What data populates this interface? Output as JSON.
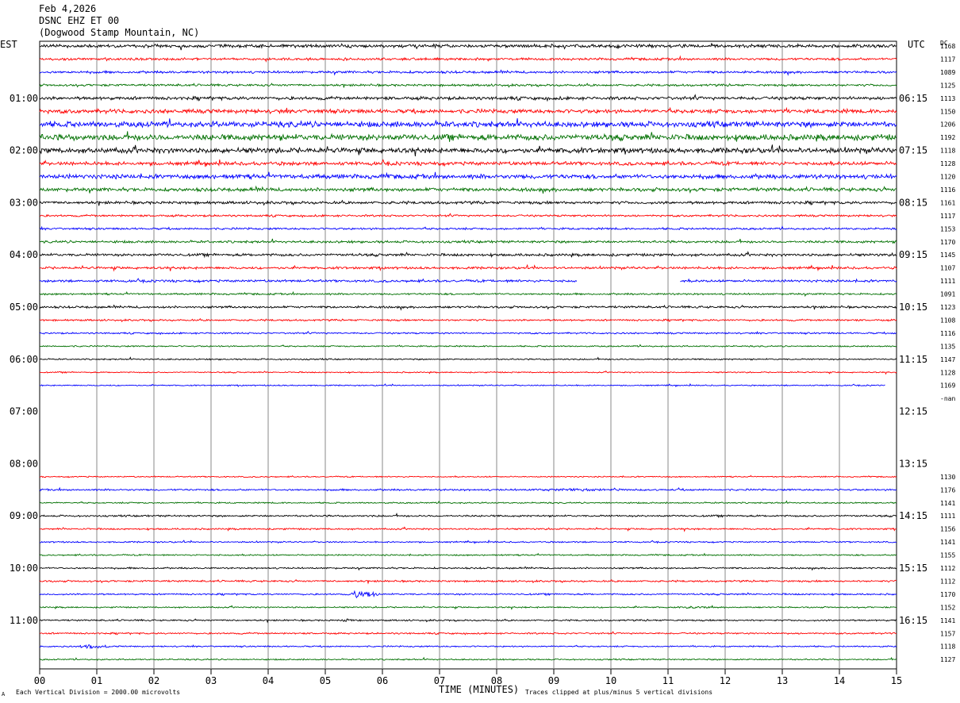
{
  "header": {
    "date": "Feb 4,2026",
    "station": "DSNC EHZ ET 00",
    "location": "(Dogwood Stamp Mountain, NC)"
  },
  "left_timezone": "EST",
  "right_timezone": "UTC",
  "dc_label": "DC",
  "footer": {
    "scale_note": "Each Vertical Division = 2000.00 microvolts",
    "clip_note": "Traces clipped at plus/minus 5 vertical divisions",
    "corner_mark": "A"
  },
  "chart_data": {
    "type": "line",
    "title": "",
    "xlabel": "TIME (MINUTES)",
    "ylabel": "",
    "xlim": [
      0,
      15
    ],
    "x_ticks": [
      "00",
      "01",
      "02",
      "03",
      "04",
      "05",
      "06",
      "07",
      "08",
      "09",
      "10",
      "11",
      "12",
      "13",
      "14",
      "15"
    ],
    "trace_colors": [
      "#000000",
      "#ff0000",
      "#0000ff",
      "#007000"
    ],
    "left_hour_labels": [
      "01:00",
      "02:00",
      "03:00",
      "04:00",
      "05:00",
      "06:00",
      "07:00",
      "08:00",
      "09:00",
      "10:00",
      "11:00"
    ],
    "right_hour_labels": [
      "06:15",
      "07:15",
      "08:15",
      "09:15",
      "10:15",
      "11:15",
      "12:15",
      "13:15",
      "14:15",
      "15:15",
      "16:15"
    ],
    "rows": [
      {
        "row": 0,
        "dc": "1168",
        "level": 1.6
      },
      {
        "row": 1,
        "dc": "1117",
        "level": 1.2
      },
      {
        "row": 2,
        "dc": "1089",
        "level": 1.2
      },
      {
        "row": 3,
        "dc": "1125",
        "level": 1.1
      },
      {
        "row": 4,
        "dc": "1113",
        "level": 1.6
      },
      {
        "row": 5,
        "dc": "1150",
        "level": 2.0
      },
      {
        "row": 6,
        "dc": "1206",
        "level": 2.8
      },
      {
        "row": 7,
        "dc": "1192",
        "level": 3.0
      },
      {
        "row": 8,
        "dc": "1118",
        "level": 2.6
      },
      {
        "row": 9,
        "dc": "1128",
        "level": 1.8
      },
      {
        "row": 10,
        "dc": "1120",
        "level": 2.2
      },
      {
        "row": 11,
        "dc": "1116",
        "level": 1.8
      },
      {
        "row": 12,
        "dc": "1161",
        "level": 1.4
      },
      {
        "row": 13,
        "dc": "1117",
        "level": 1.0
      },
      {
        "row": 14,
        "dc": "1153",
        "level": 1.0
      },
      {
        "row": 15,
        "dc": "1170",
        "level": 1.2
      },
      {
        "row": 16,
        "dc": "1145",
        "level": 1.3
      },
      {
        "row": 17,
        "dc": "1107",
        "level": 1.2
      },
      {
        "row": 18,
        "dc": "1111",
        "level": 1.2,
        "gaps": [
          [
            9.4,
            11.2
          ]
        ]
      },
      {
        "row": 19,
        "dc": "1091",
        "level": 0.9
      },
      {
        "row": 20,
        "dc": "1123",
        "level": 1.1
      },
      {
        "row": 21,
        "dc": "1108",
        "level": 0.9
      },
      {
        "row": 22,
        "dc": "1116",
        "level": 0.8
      },
      {
        "row": 23,
        "dc": "1135",
        "level": 0.7
      },
      {
        "row": 24,
        "dc": "1147",
        "level": 0.7
      },
      {
        "row": 25,
        "dc": "1128",
        "level": 0.6
      },
      {
        "row": 26,
        "dc": "1169",
        "level": 0.6,
        "end": 14.8
      },
      {
        "row": 27,
        "dc": "-nan",
        "level": 0,
        "empty": true
      },
      {
        "row": 28,
        "dc": "",
        "level": 0,
        "empty": true
      },
      {
        "row": 29,
        "dc": "",
        "level": 0,
        "empty": true
      },
      {
        "row": 30,
        "dc": "",
        "level": 0,
        "empty": true
      },
      {
        "row": 31,
        "dc": "",
        "level": 0,
        "empty": true
      },
      {
        "row": 32,
        "dc": "",
        "level": 0,
        "empty": true
      },
      {
        "row": 33,
        "dc": "1130",
        "level": 0.6
      },
      {
        "row": 34,
        "dc": "1176",
        "level": 0.9
      },
      {
        "row": 35,
        "dc": "1141",
        "level": 0.7
      },
      {
        "row": 36,
        "dc": "1111",
        "level": 0.9
      },
      {
        "row": 37,
        "dc": "1156",
        "level": 0.8
      },
      {
        "row": 38,
        "dc": "1141",
        "level": 0.7
      },
      {
        "row": 39,
        "dc": "1155",
        "level": 0.7
      },
      {
        "row": 40,
        "dc": "1112",
        "level": 0.8
      },
      {
        "row": 41,
        "dc": "1112",
        "level": 0.9
      },
      {
        "row": 42,
        "dc": "1170",
        "level": 0.8
      },
      {
        "row": 43,
        "dc": "1152",
        "level": 0.7
      },
      {
        "row": 44,
        "dc": "1141",
        "level": 0.8
      },
      {
        "row": 45,
        "dc": "1157",
        "level": 0.8
      },
      {
        "row": 46,
        "dc": "1118",
        "level": 0.7
      },
      {
        "row": 47,
        "dc": "1127",
        "level": 0.7
      }
    ],
    "events": [
      {
        "row": 42,
        "start": 5.45,
        "end": 5.95,
        "amplitude": 5
      },
      {
        "row": 46,
        "start": 0.7,
        "end": 1.3,
        "amplitude": 2.5
      },
      {
        "row": 34,
        "start": 8.6,
        "end": 11.2,
        "amplitude": 1.6
      },
      {
        "row": 44,
        "start": 5.3,
        "end": 5.6,
        "amplitude": 2.5
      },
      {
        "row": 43,
        "start": 11.3,
        "end": 11.8,
        "amplitude": 2.0
      }
    ]
  }
}
